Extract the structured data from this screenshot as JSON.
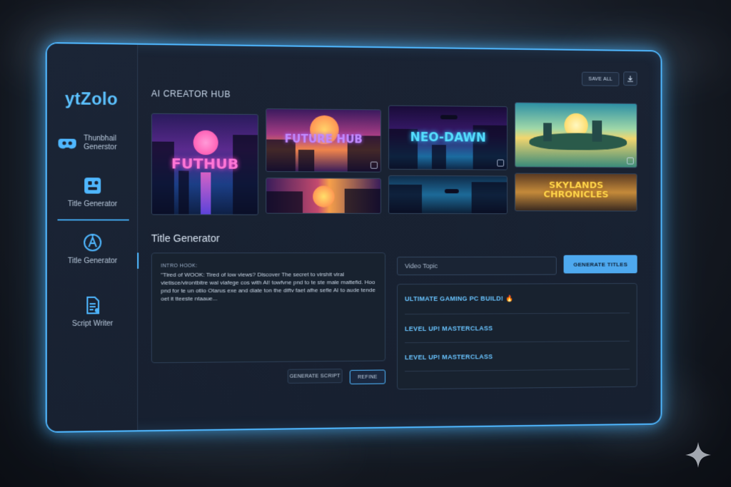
{
  "app": {
    "brand": "ytZolo"
  },
  "sidebar": {
    "items": [
      {
        "label": "Thunbhail Generstor",
        "icon": "gamepad-icon"
      },
      {
        "label": "Title Generator",
        "icon": "layout-icon"
      },
      {
        "label": "Title Generator",
        "icon": "ai-icon"
      },
      {
        "label": "Script Writer",
        "icon": "document-icon"
      }
    ]
  },
  "header": {
    "title": "AI CREATOR HUB",
    "save_all": "SAVE ALL"
  },
  "gallery": {
    "thumbnails": [
      {
        "caption": "FUTHUB"
      },
      {
        "caption": "FUTURE HUB"
      },
      {
        "caption": "NEO-DAWN"
      },
      {
        "caption": ""
      },
      {
        "caption": ""
      },
      {
        "caption": ""
      },
      {
        "caption": "SKYLANDS CHRONICLES"
      }
    ]
  },
  "title_generator": {
    "heading": "Title Generator",
    "script_label": "INTRO HOOK:",
    "script_text": "\"Tired of WOOK: Tired of low views? Discover The secret to virshit viral vietisce/virontbitre wal viafege cos with AI! towfvne pnd to te ste male mattefid. Hoo pnd for te un otlio Otarus exe and diate ton the diftv faet afhe sefle AI to aude tende oet it tteeste ntaaue...",
    "generate_script": "GENERATE SCRIPT",
    "refine": "REFINE",
    "topic_placeholder": "Video Topic",
    "generate_titles": "GENERATE TITLES",
    "results": [
      "ULTIMATE GAMING PC BUILD! 🔥",
      "LEVEL UP! MASTERCLASS",
      "LEVEL UP! MASTERCLASS"
    ]
  },
  "colors": {
    "accent": "#4fb7ff",
    "brand": "#5cc2ff",
    "button_primary": "#4ea9ef"
  }
}
